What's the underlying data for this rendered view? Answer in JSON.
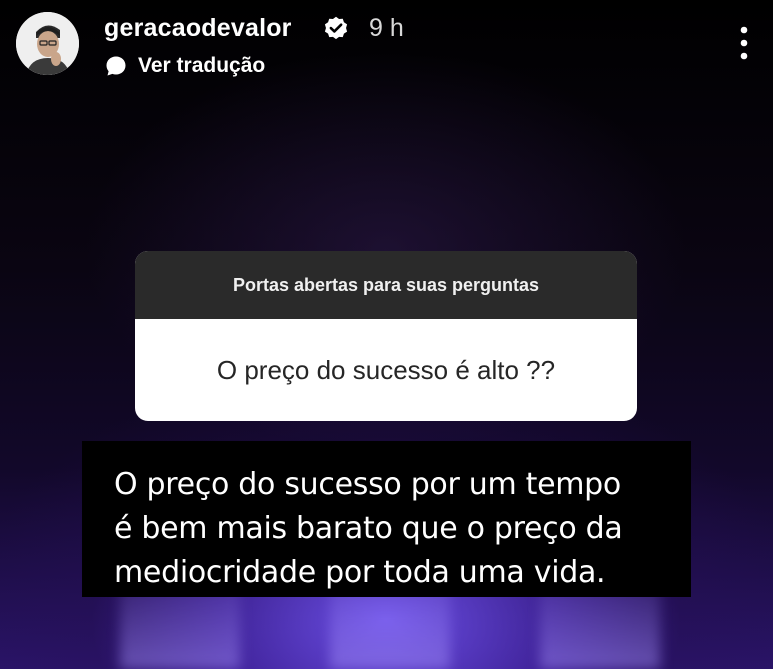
{
  "story": {
    "username": "geracaodevalor",
    "time_ago": "9 h",
    "translate_label": "Ver tradução",
    "question_box": {
      "header": "Portas abertas para suas perguntas",
      "question": "O preço do sucesso é alto ??"
    },
    "answer_lines": [
      "O preço do sucesso por um tempo",
      "é bem mais barato que o preço da",
      "mediocridade por toda uma vida."
    ]
  },
  "icons": {
    "avatar": "profile-photo",
    "verified": "verified-badge-icon",
    "translate": "speech-bubble-icon",
    "menu": "more-vertical-icon"
  },
  "colors": {
    "background": "#000000",
    "glow": "#7a5cff",
    "question_header_bg": "#2a2a2a",
    "question_body_bg": "#ffffff",
    "question_text": "#262626"
  }
}
